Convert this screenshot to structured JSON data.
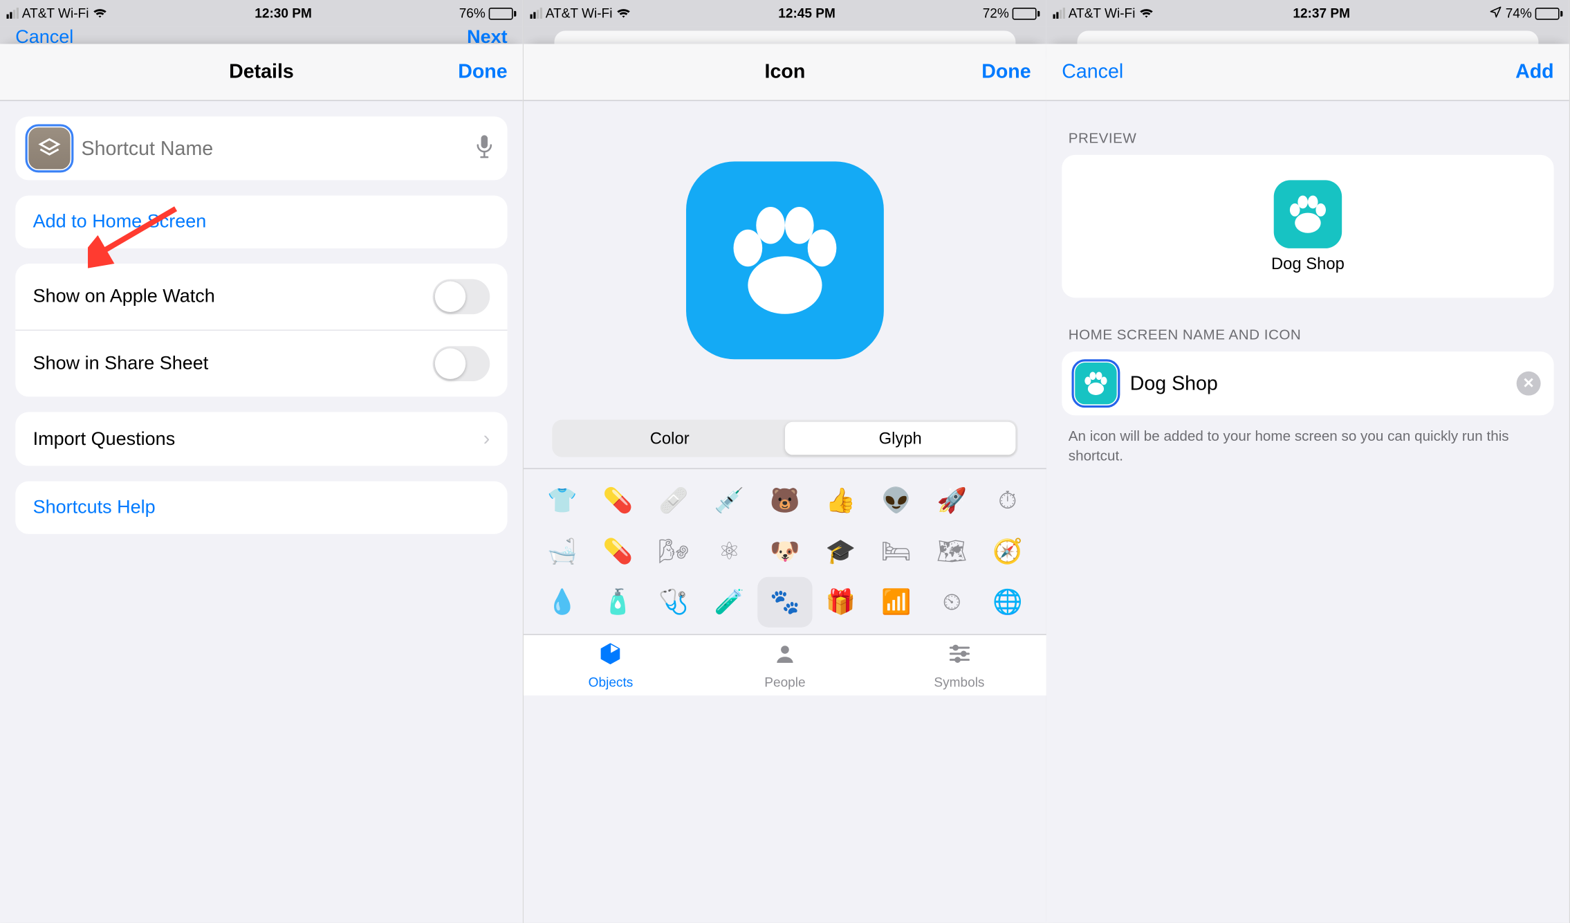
{
  "panel1": {
    "status": {
      "carrier": "AT&T Wi-Fi",
      "time": "12:30 PM",
      "battery_pct": "76%",
      "battery_fill": 76
    },
    "backdrop": {
      "cancel": "Cancel",
      "next": "Next"
    },
    "nav": {
      "title": "Details",
      "done": "Done"
    },
    "name_placeholder": "Shortcut Name",
    "rows": {
      "add_home": "Add to Home Screen",
      "apple_watch": "Show on Apple Watch",
      "share_sheet": "Show in Share Sheet",
      "import_q": "Import Questions",
      "help": "Shortcuts Help"
    }
  },
  "panel2": {
    "status": {
      "carrier": "AT&T Wi-Fi",
      "time": "12:45 PM",
      "battery_pct": "72%",
      "battery_fill": 72
    },
    "nav": {
      "title": "Icon",
      "done": "Done"
    },
    "segments": {
      "color": "Color",
      "glyph": "Glyph"
    },
    "tabs": {
      "objects": "Objects",
      "people": "People",
      "symbols": "Symbols"
    },
    "glyph_names": [
      "shirt",
      "pill",
      "bandage",
      "syringe",
      "bear",
      "thumbs-up",
      "alien",
      "rocket",
      "gauge",
      "bath",
      "pills",
      "inhaler",
      "atom",
      "dog",
      "graduation-cap",
      "bed",
      "map",
      "compass",
      "dropper",
      "medicine-bottle",
      "stethoscope",
      "flask",
      "paw",
      "gift",
      "stairs",
      "speedometer",
      "globe"
    ],
    "glyph_icons": [
      "👕",
      "💊",
      "🩹",
      "💉",
      "🐻",
      "👍",
      "👽",
      "🚀",
      "⏱",
      "🛁",
      "💊",
      "🌬",
      "⚛",
      "🐶",
      "🎓",
      "🛏",
      "🗺",
      "🧭",
      "💧",
      "🧴",
      "🩺",
      "🧪",
      "🐾",
      "🎁",
      "📶",
      "⏲",
      "🌐"
    ],
    "selected_glyph_index": 22
  },
  "panel3": {
    "status": {
      "carrier": "AT&T Wi-Fi",
      "time": "12:37 PM",
      "battery_pct": "74%",
      "battery_fill": 74,
      "location": true
    },
    "nav": {
      "cancel": "Cancel",
      "add": "Add"
    },
    "headers": {
      "preview": "PREVIEW",
      "name_icon": "HOME SCREEN NAME AND ICON"
    },
    "preview_label": "Dog Shop",
    "name_value": "Dog Shop",
    "footnote": "An icon will be added to your home screen so you can quickly run this shortcut."
  }
}
